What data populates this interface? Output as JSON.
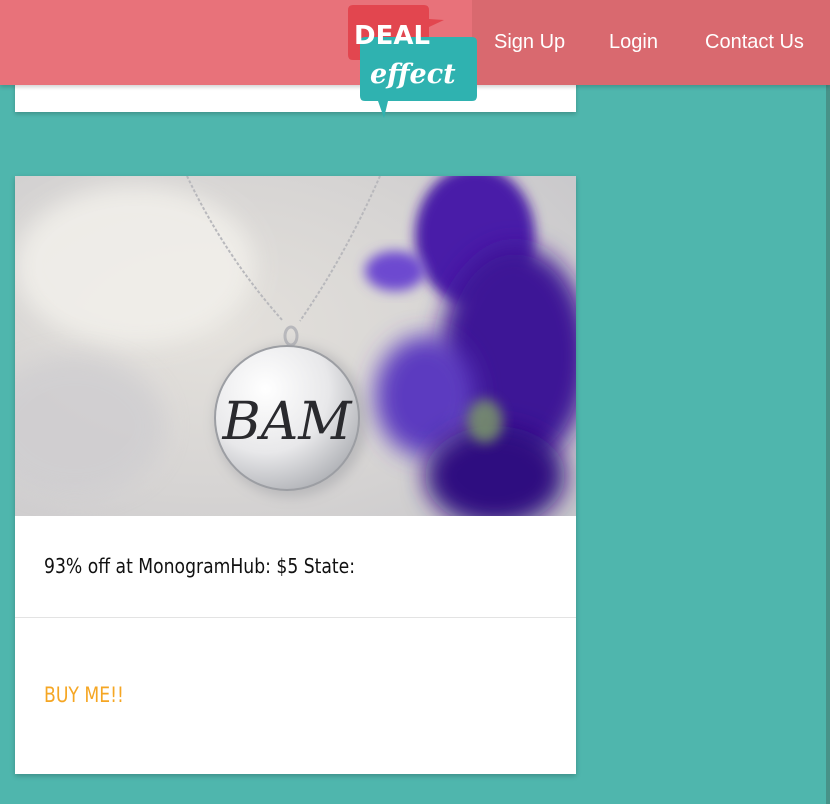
{
  "brand": {
    "logo_top": "DEAL",
    "logo_bottom": "effect",
    "colors": {
      "background": "#4fb6ad",
      "header": "#e8727a",
      "header_right": "#d9696f",
      "logo_red": "#e2464f",
      "logo_teal": "#2fb2b0",
      "buy_link": "#f5a623"
    }
  },
  "nav": {
    "signup": "Sign Up",
    "login": "Login",
    "contact": "Contact Us"
  },
  "deal": {
    "image_icon": "monogram-necklace-photo",
    "monogram": "BAM",
    "title": "93% off at MonogramHub: $5 State:",
    "cta": "BUY ME!!"
  }
}
